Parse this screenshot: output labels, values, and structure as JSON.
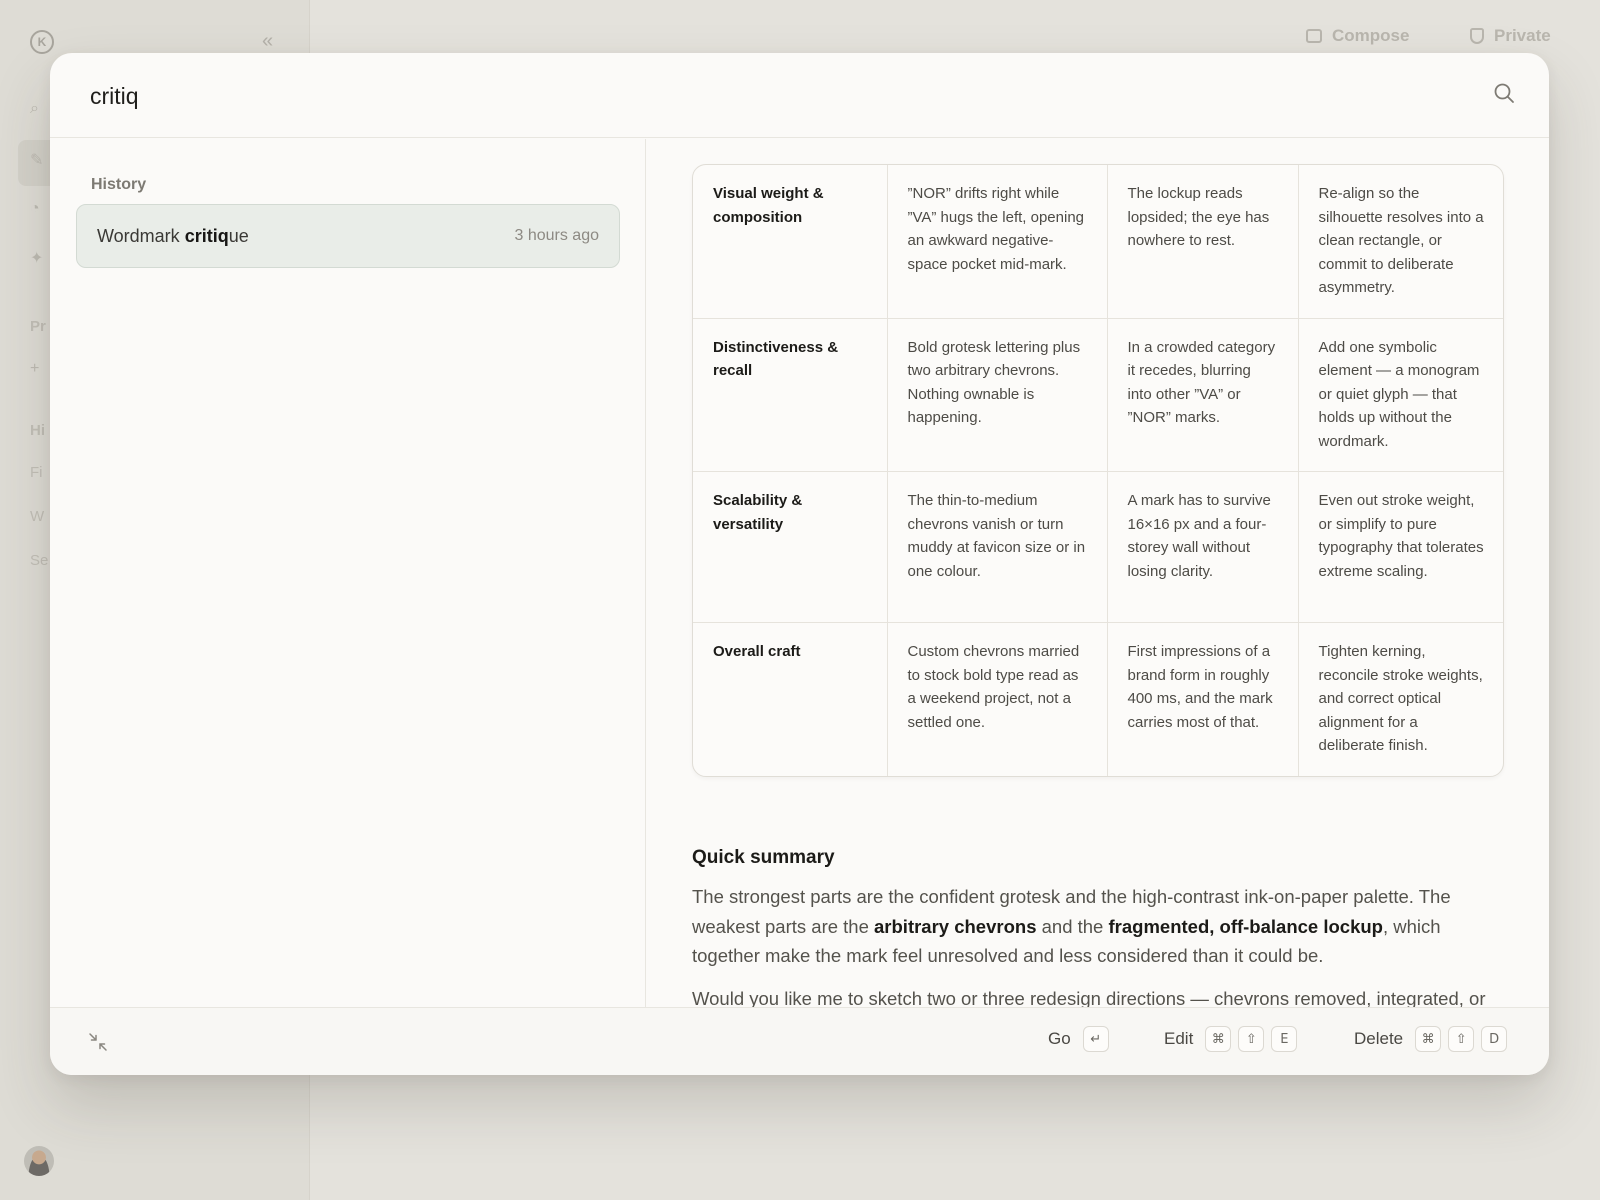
{
  "background": {
    "logo_letter": "K",
    "topbar": {
      "compose_label": "Compose",
      "private_label": "Private"
    },
    "sidebar_fragments": [
      "Pr",
      "Hi",
      "Fi",
      "W",
      "Se"
    ]
  },
  "search": {
    "value": "critiq",
    "placeholder": ""
  },
  "history": {
    "heading": "History",
    "items": [
      {
        "title_before": "Wordmark ",
        "title_match": "critiq",
        "title_after": "ue",
        "time": "3 hours ago"
      }
    ]
  },
  "critique_table": {
    "rows": [
      {
        "criterion": "Visual weight & composition",
        "observation": "”NOR” drifts right while ”VA” hugs the left, opening an awkward negative-space pocket mid-mark.",
        "impact": "The lockup reads lopsided; the eye has nowhere to rest.",
        "suggestion": "Re-align so the silhouette resolves into a clean rectangle, or commit to deliberate asymmetry."
      },
      {
        "criterion": "Distinctiveness & recall",
        "observation": "Bold grotesk lettering plus two arbitrary chevrons. Nothing ownable is happening.",
        "impact": "In a crowded category it recedes, blurring into other ”VA” or ”NOR” marks.",
        "suggestion": "Add one symbolic element — a monogram or quiet glyph — that holds up without the wordmark."
      },
      {
        "criterion": "Scalability & versatility",
        "observation": "The thin-to-medium chevrons vanish or turn muddy at favicon size or in one colour.",
        "impact": "A mark has to survive 16×16 px and a four-storey wall without losing clarity.",
        "suggestion": "Even out stroke weight, or simplify to pure typography that tolerates extreme scaling."
      },
      {
        "criterion": "Overall craft",
        "observation": "Custom chevrons married to stock bold type read as a weekend project, not a settled one.",
        "impact": "First impressions of a brand form in roughly 400 ms, and the mark carries most of that.",
        "suggestion": "Tighten kerning, reconcile stroke weights, and correct optical alignment for a deliberate finish."
      }
    ]
  },
  "summary": {
    "title": "Quick summary",
    "p1_a": "The strongest parts are the confident grotesk and the high-contrast ink-on-paper palette. The weakest parts are the ",
    "p1_b1": "arbitrary chevrons",
    "p1_c": " and the ",
    "p1_b2": "fragmented, off-balance lockup",
    "p1_d": ", which together make the mark feel unresolved and less considered than it could be.",
    "p2": "Would you like me to sketch two or three redesign directions — chevrons removed, integrated, or replaced — so you can compare them side by side?"
  },
  "footer": {
    "go": {
      "label": "Go",
      "keys": [
        "↵"
      ]
    },
    "edit": {
      "label": "Edit",
      "keys": [
        "⌘",
        "⇧",
        "E"
      ]
    },
    "delete": {
      "label": "Delete",
      "keys": [
        "⌘",
        "⇧",
        "D"
      ]
    }
  },
  "colors": {
    "modal_bg": "#fbfaf8",
    "selected_item_bg": "#e9ede8",
    "page_bg": "#e4e2dc"
  }
}
